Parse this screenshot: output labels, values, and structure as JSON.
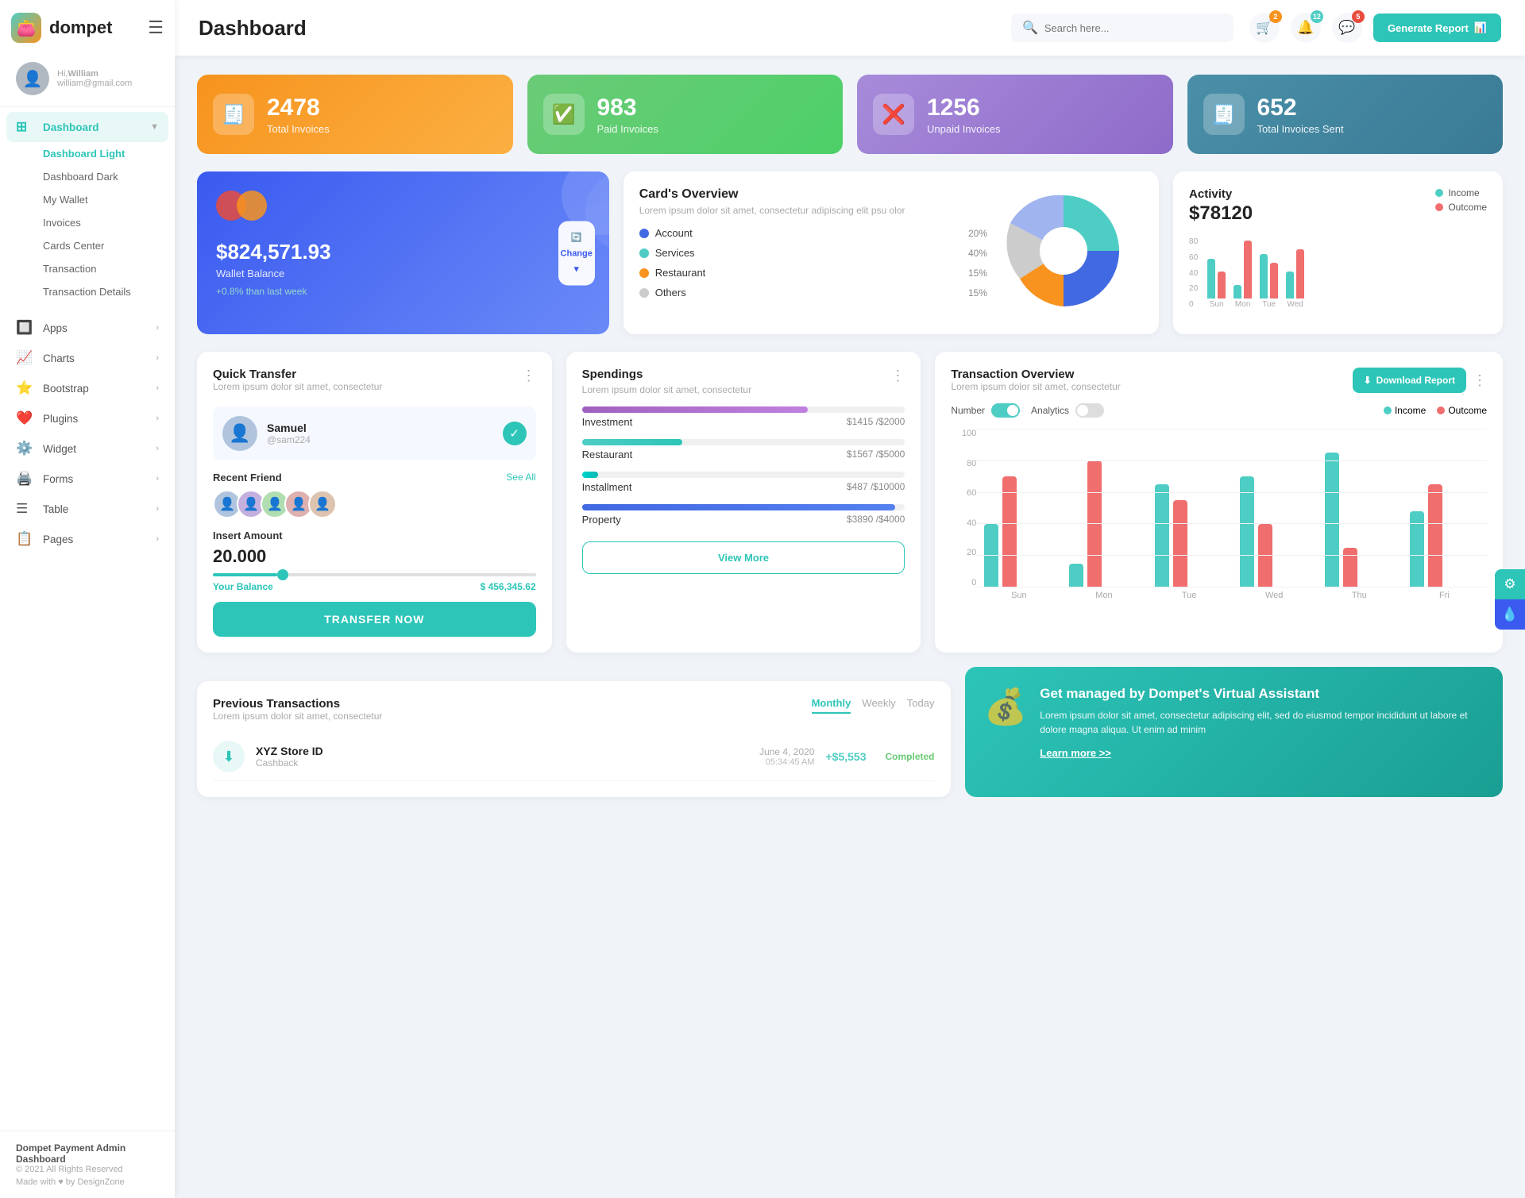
{
  "app": {
    "name": "dompet",
    "logo_emoji": "👛"
  },
  "header": {
    "title": "Dashboard",
    "search_placeholder": "Search here...",
    "generate_btn": "Generate Report",
    "icons": {
      "cart_badge": "2",
      "bell_badge": "12",
      "chat_badge": "5"
    }
  },
  "user": {
    "greeting": "Hi,",
    "name": "William",
    "email": "william@gmail.com"
  },
  "sidebar": {
    "nav_items": [
      {
        "id": "dashboard",
        "label": "Dashboard",
        "icon": "⊞",
        "active": true,
        "has_sub": true
      },
      {
        "id": "apps",
        "label": "Apps",
        "icon": "🔲",
        "has_chevron": true
      },
      {
        "id": "charts",
        "label": "Charts",
        "icon": "📈",
        "has_chevron": true
      },
      {
        "id": "bootstrap",
        "label": "Bootstrap",
        "icon": "⭐",
        "has_chevron": true
      },
      {
        "id": "plugins",
        "label": "Plugins",
        "icon": "❤️",
        "has_chevron": true
      },
      {
        "id": "widget",
        "label": "Widget",
        "icon": "⚙️",
        "has_chevron": true
      },
      {
        "id": "forms",
        "label": "Forms",
        "icon": "🖨️",
        "has_chevron": true
      },
      {
        "id": "table",
        "label": "Table",
        "icon": "☰",
        "has_chevron": true
      },
      {
        "id": "pages",
        "label": "Pages",
        "icon": "📋",
        "has_chevron": true
      }
    ],
    "sub_items": [
      {
        "label": "Dashboard Light",
        "active": true
      },
      {
        "label": "Dashboard Dark",
        "active": false
      },
      {
        "label": "My Wallet",
        "active": false
      },
      {
        "label": "Invoices",
        "active": false
      },
      {
        "label": "Cards Center",
        "active": false
      },
      {
        "label": "Transaction",
        "active": false
      },
      {
        "label": "Transaction Details",
        "active": false
      }
    ],
    "footer": {
      "brand": "Dompet Payment Admin Dashboard",
      "copy": "© 2021 All Rights Reserved",
      "made_with": "Made with ♥ by DesignZone"
    }
  },
  "stats": [
    {
      "id": "total-invoices",
      "number": "2478",
      "label": "Total Invoices",
      "icon": "🧾",
      "color": "orange"
    },
    {
      "id": "paid-invoices",
      "number": "983",
      "label": "Paid Invoices",
      "icon": "✅",
      "color": "green"
    },
    {
      "id": "unpaid-invoices",
      "number": "1256",
      "label": "Unpaid Invoices",
      "icon": "❌",
      "color": "purple"
    },
    {
      "id": "total-sent",
      "number": "652",
      "label": "Total Invoices Sent",
      "icon": "🧾",
      "color": "teal"
    }
  ],
  "wallet": {
    "amount": "$824,571.93",
    "label": "Wallet Balance",
    "change": "+0.8% than last week",
    "change_btn": "Change"
  },
  "cards_overview": {
    "title": "Card's Overview",
    "desc": "Lorem ipsum dolor sit amet, consectetur adipiscing elit psu olor",
    "items": [
      {
        "name": "Account",
        "pct": "20%",
        "color": "#4169e1"
      },
      {
        "name": "Services",
        "pct": "40%",
        "color": "#4ecdc4"
      },
      {
        "name": "Restaurant",
        "pct": "15%",
        "color": "#f7931e"
      },
      {
        "name": "Others",
        "pct": "15%",
        "color": "#cccccc"
      }
    ]
  },
  "activity": {
    "title": "Activity",
    "amount": "$78120",
    "legend": [
      {
        "name": "Income",
        "color": "#4ecdc4"
      },
      {
        "name": "Outcome",
        "color": "#f06e6e"
      }
    ],
    "bars": [
      {
        "day": "Sun",
        "income": 45,
        "outcome": 30
      },
      {
        "day": "Mon",
        "income": 15,
        "outcome": 65
      },
      {
        "day": "Tue",
        "income": 50,
        "outcome": 40
      },
      {
        "day": "Wed",
        "income": 30,
        "outcome": 55
      }
    ]
  },
  "quick_transfer": {
    "title": "Quick Transfer",
    "desc": "Lorem ipsum dolor sit amet, consectetur",
    "user": {
      "name": "Samuel",
      "handle": "@sam224"
    },
    "recent_friend_label": "Recent Friend",
    "see_all": "See All",
    "insert_amount_label": "Insert Amount",
    "amount": "20.000",
    "balance_label": "Your Balance",
    "balance": "$ 456,345.62",
    "transfer_btn": "TRANSFER NOW"
  },
  "spendings": {
    "title": "Spendings",
    "desc": "Lorem ipsum dolor sit amet, consectetur",
    "items": [
      {
        "name": "Investment",
        "current": "$1415",
        "total": "$2000",
        "pct": 70,
        "color": "#a060c0"
      },
      {
        "name": "Restaurant",
        "current": "$1567",
        "total": "$5000",
        "pct": 31,
        "color": "#4ecdc4"
      },
      {
        "name": "Installment",
        "current": "$487",
        "total": "$10000",
        "pct": 5,
        "color": "#00d4cc"
      },
      {
        "name": "Property",
        "current": "$3890",
        "total": "$4000",
        "pct": 97,
        "color": "#4169e1"
      }
    ],
    "view_more_btn": "View More"
  },
  "transaction_overview": {
    "title": "Transaction Overview",
    "desc": "Lorem ipsum dolor sit amet, consectetur",
    "download_btn": "Download Report",
    "toggle_number": "Number",
    "toggle_analytics": "Analytics",
    "legend_income": "Income",
    "legend_outcome": "Outcome",
    "bars": [
      {
        "day": "Sun",
        "income": 40,
        "outcome": 70
      },
      {
        "day": "Mon",
        "income": 15,
        "outcome": 80
      },
      {
        "day": "Tue",
        "income": 65,
        "outcome": 55
      },
      {
        "day": "Wed",
        "income": 70,
        "outcome": 40
      },
      {
        "day": "Thu",
        "income": 85,
        "outcome": 25
      },
      {
        "day": "Fri",
        "income": 48,
        "outcome": 65
      }
    ],
    "y_labels": [
      "100",
      "80",
      "60",
      "40",
      "20",
      "0"
    ]
  },
  "previous_transactions": {
    "title": "Previous Transactions",
    "desc": "Lorem ipsum dolor sit amet, consectetur",
    "tabs": [
      "Monthly",
      "Weekly",
      "Today"
    ],
    "active_tab": "Monthly",
    "items": [
      {
        "name": "XYZ Store ID",
        "type": "Cashback",
        "date": "June 4, 2020",
        "time": "05:34:45 AM",
        "amount": "+$5,553",
        "status": "Completed",
        "icon": "⬇️"
      }
    ]
  },
  "virtual_assistant": {
    "title": "Get managed by Dompet's Virtual Assistant",
    "desc": "Lorem ipsum dolor sit amet, consectetur adipiscing elit, sed do eiusmod tempor incididunt ut labore et dolore magna aliqua. Ut enim ad minim",
    "link": "Learn more >>"
  }
}
